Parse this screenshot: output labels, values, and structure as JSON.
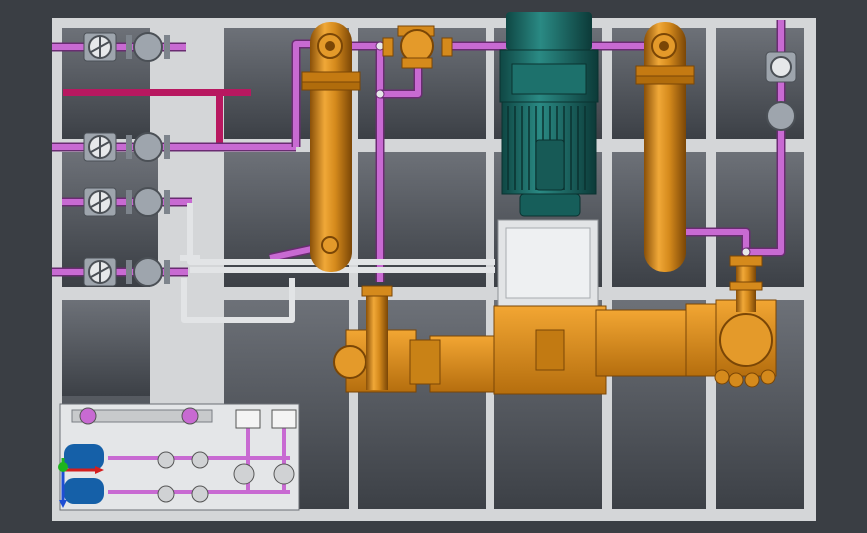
{
  "scene": {
    "background": "#3a3e44",
    "frame_color": "#cfd1d3",
    "panel_gradient_top": "#6d7178",
    "panel_gradient_bottom": "#3c4046",
    "pipe_color": "#c86ad2",
    "pipe_outline": "#6a2c72",
    "steam_pipe_color": "#b81860",
    "white_pipe_color": "#e2e4e6",
    "tank_color": "#d58a1c",
    "tank_shadow": "#8a5008",
    "motor_color": "#1b6a66",
    "motor_dark": "#0f4744",
    "valve_color": "#9ea5ad",
    "gearbox_color": "#d98e1c"
  },
  "inset": {
    "triad_colors": {
      "x": "#d41e1e",
      "y": "#1eb41e",
      "z": "#1e4ed4"
    },
    "tank_color": "#1560a8"
  }
}
